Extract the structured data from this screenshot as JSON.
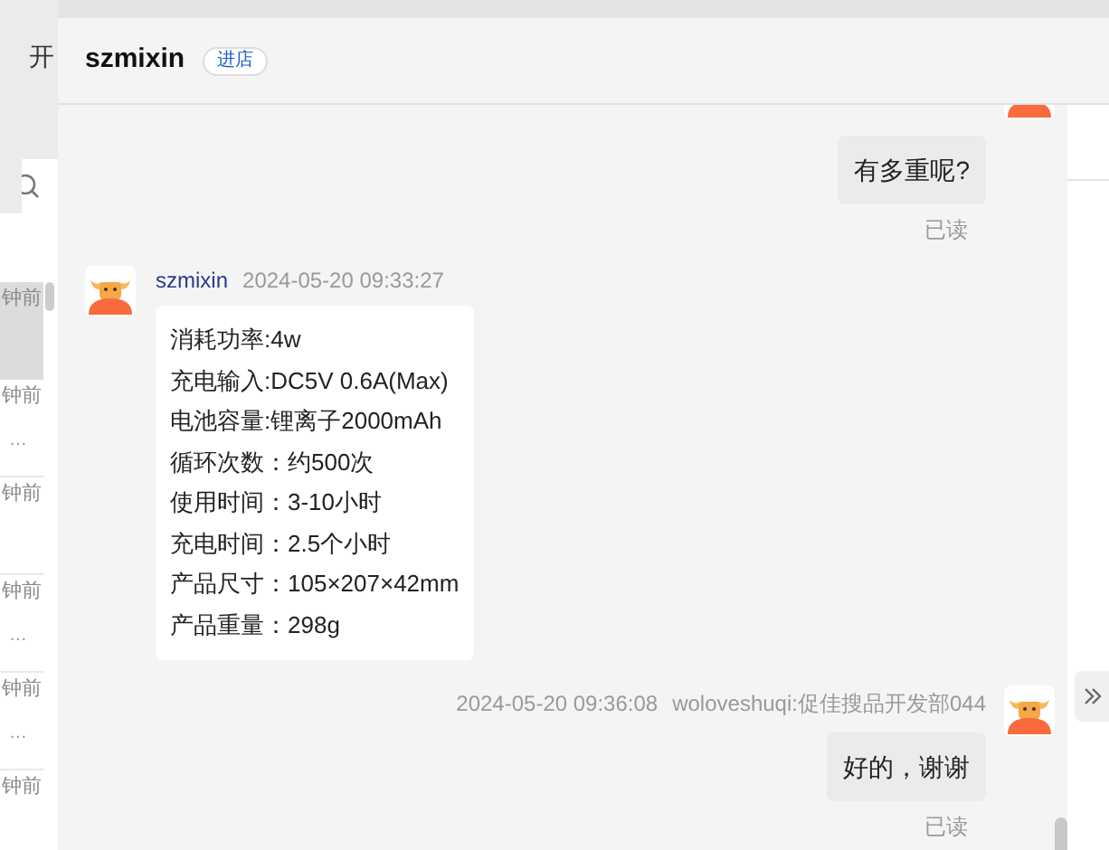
{
  "sidebar": {
    "title_fragment": "开",
    "items": [
      {
        "time": "钟前",
        "selected": true
      },
      {
        "time": "钟前",
        "preview": "…",
        "selected": false
      },
      {
        "time": "钟前",
        "selected": false
      },
      {
        "time": "钟前",
        "preview": "…",
        "selected": false
      },
      {
        "time": "钟前",
        "preview": "…",
        "selected": false
      },
      {
        "time": "钟前",
        "selected": false
      }
    ]
  },
  "chat": {
    "title": "szmixin",
    "badge": "进店",
    "messages": [
      {
        "kind": "outgoing",
        "text": "有多重呢?",
        "status": "已读"
      },
      {
        "kind": "incoming",
        "sender": "szmixin",
        "time": "2024-05-20 09:33:27",
        "lines": [
          "消耗功率:4w",
          "充电输入:DC5V 0.6A(Max)",
          "电池容量:锂离子2000mAh",
          "循环次数：约500次",
          "使用时间：3-10小时",
          "充电时间：2.5个小时",
          "产品尺寸：105×207×42mm",
          "产品重量：298g"
        ]
      },
      {
        "kind": "outgoing",
        "time": "2024-05-20 09:36:08",
        "sender": "woloveshuqi:促佳搜品开发部044",
        "text": "好的，谢谢",
        "status": "已读"
      }
    ]
  }
}
